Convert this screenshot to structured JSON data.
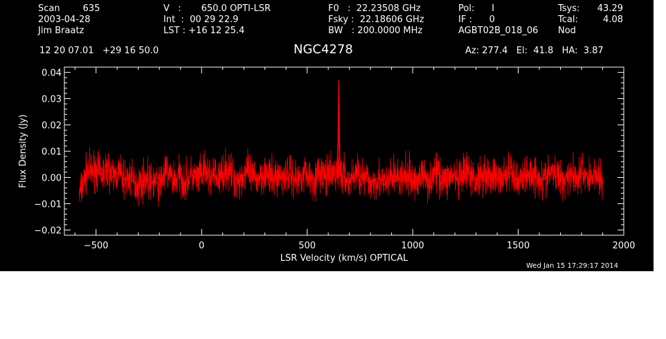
{
  "header": {
    "col1": [
      "Scan        635",
      "2003-04-28",
      "Jim Braatz"
    ],
    "col2": [
      "V   :       650.0 OPTI-LSR",
      "Int  :  00 29 22.9",
      "LST : +16 12 25.4"
    ],
    "col3": [
      "F0   :  22.23508 GHz",
      "Fsky :  22.18606 GHz",
      "BW   : 200.0000 MHz"
    ],
    "col4": [
      "Pol:      I",
      "IF :      0",
      "AGBT02B_018_06"
    ],
    "col5": [
      "Tsys:",
      "Tcal:",
      "Nod"
    ],
    "col6": [
      "43.29",
      "4.08",
      ""
    ],
    "coords": "12 20 07.01   +29 16 50.0",
    "source": "NGC4278",
    "azelha": "Az: 277.4   El:  41.8   HA:  3.87",
    "timestamp": "Wed Jan 15 17:29:17 2014"
  },
  "colors": {
    "background": "#000000",
    "axes": "#ffffff",
    "trace": "#ff0000"
  },
  "chart_data": {
    "type": "line",
    "title": "NGC4278",
    "xlabel": "LSR Velocity (km/s) OPTICAL",
    "ylabel": "Flux Density (Jy)",
    "xlim": [
      -650,
      2000
    ],
    "ylim": [
      -0.022,
      0.042
    ],
    "xticks": [
      -500,
      0,
      500,
      1000,
      1500,
      2000
    ],
    "xtick_labels": [
      "−500",
      "0",
      "500",
      "1000",
      "1500",
      "2000"
    ],
    "yticks": [
      -0.02,
      -0.01,
      0.0,
      0.01,
      0.02,
      0.03,
      0.04
    ],
    "ytick_labels": [
      "−0.02",
      "−0.01",
      "0.00",
      "0.01",
      "0.02",
      "0.03",
      "0.04"
    ],
    "grid": false,
    "series": [
      {
        "color": "#ff0000",
        "x": [
          -580,
          -560,
          -540,
          -520,
          -500,
          -480,
          -460,
          -440,
          -420,
          -400,
          -380,
          -360,
          -340,
          -320,
          -300,
          -280,
          -260,
          -240,
          -220,
          -200,
          -180,
          -160,
          -140,
          -120,
          -100,
          -80,
          -60,
          -40,
          -20,
          0,
          20,
          40,
          60,
          80,
          100,
          120,
          140,
          160,
          180,
          200,
          220,
          240,
          260,
          280,
          300,
          320,
          340,
          360,
          380,
          400,
          420,
          440,
          460,
          480,
          500,
          520,
          540,
          560,
          580,
          600,
          620,
          640,
          645,
          650,
          655,
          660,
          680,
          700,
          720,
          740,
          760,
          780,
          800,
          820,
          840,
          860,
          880,
          900,
          920,
          940,
          960,
          980,
          1000,
          1020,
          1040,
          1060,
          1080,
          1100,
          1120,
          1140,
          1160,
          1180,
          1200,
          1220,
          1240,
          1260,
          1280,
          1300,
          1320,
          1340,
          1360,
          1380,
          1400,
          1420,
          1440,
          1460,
          1480,
          1500,
          1520,
          1540,
          1560,
          1580,
          1600,
          1620,
          1640,
          1660,
          1680,
          1700,
          1720,
          1740,
          1760,
          1780,
          1800,
          1820,
          1840,
          1860,
          1880,
          1900
        ],
        "y": [
          -0.007,
          -0.002,
          0.003,
          0.002,
          0.004,
          0.001,
          0.002,
          0.003,
          0.0,
          0.002,
          0.001,
          -0.001,
          0.0,
          -0.002,
          -0.003,
          -0.001,
          0.0,
          -0.002,
          -0.001,
          -0.003,
          0.001,
          0.002,
          0.0,
          -0.001,
          0.001,
          -0.002,
          0.0,
          0.001,
          -0.001,
          0.001,
          0.002,
          0.0,
          0.001,
          -0.001,
          0.002,
          0.003,
          0.001,
          0.0,
          -0.001,
          0.001,
          0.002,
          0.0,
          -0.001,
          0.001,
          0.002,
          0.0,
          -0.001,
          0.001,
          0.0,
          0.002,
          0.001,
          0.0,
          -0.001,
          0.002,
          0.001,
          0.0,
          -0.001,
          0.002,
          0.001,
          0.0,
          0.001,
          0.002,
          0.012,
          0.037,
          0.008,
          0.001,
          0.0,
          -0.002,
          0.001,
          0.002,
          0.0,
          -0.001,
          -0.002,
          -0.001,
          0.0,
          -0.003,
          -0.002,
          0.0,
          0.001,
          -0.001,
          0.0,
          0.001,
          -0.002,
          -0.001,
          0.001,
          0.0,
          -0.001,
          0.001,
          0.002,
          0.0,
          -0.001,
          0.001,
          0.0,
          -0.002,
          0.001,
          0.002,
          0.0,
          -0.001,
          0.001,
          0.002,
          0.0,
          0.001,
          -0.001,
          0.0,
          0.001,
          0.002,
          0.0,
          -0.001,
          0.001,
          0.0,
          0.002,
          0.001,
          0.0,
          -0.001,
          0.001,
          0.002,
          0.0,
          0.001,
          -0.001,
          0.002,
          0.001,
          0.0,
          0.002,
          0.001,
          -0.001,
          0.002,
          0.0,
          -0.002
        ]
      }
    ]
  }
}
